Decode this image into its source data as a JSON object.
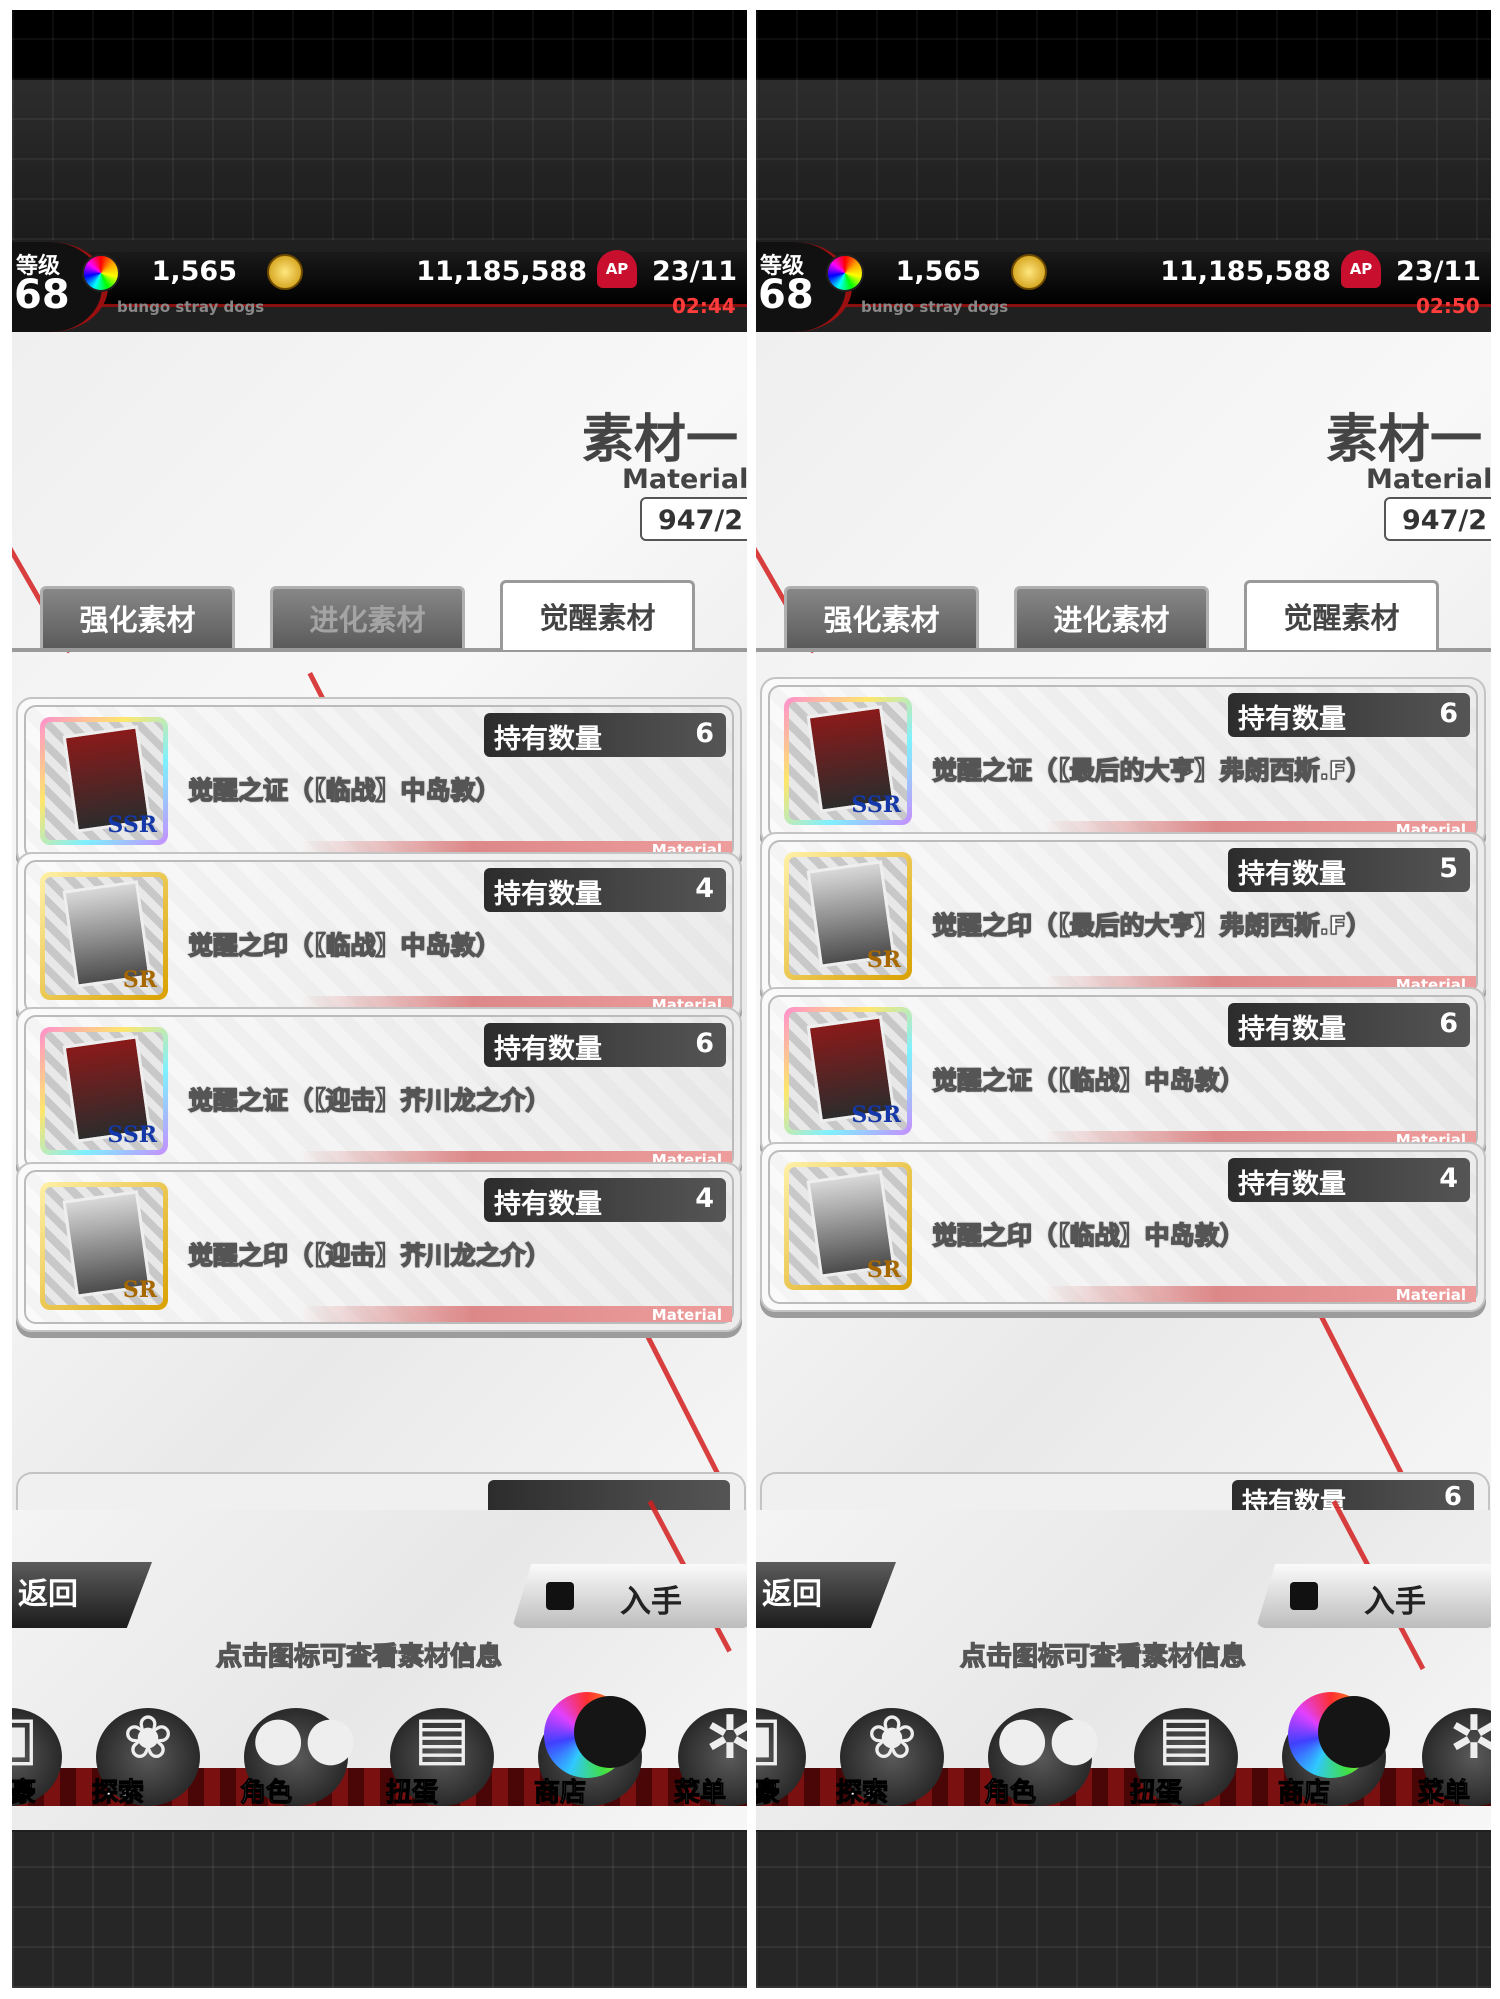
{
  "panels": [
    {
      "header": {
        "level_label": "等级",
        "level_value": "68",
        "gems": "1,565",
        "coins": "11,185,588",
        "ap_icon": "AP",
        "ap": "23/11",
        "time": "02:44",
        "subtitle": "bungo stray dogs"
      },
      "page": {
        "title": "素材一",
        "subtitle": "Material",
        "count": "947/2"
      },
      "tabs": [
        {
          "label": "强化素材",
          "state": "normal"
        },
        {
          "label": "进化素材",
          "state": "dim"
        },
        {
          "label": "觉醒素材",
          "state": "active"
        }
      ],
      "items": [
        {
          "name": "觉醒之证（【临战】中岛敦）",
          "rarity": "SSR",
          "qty_label": "持有数量",
          "qty": "6",
          "tag": "Material"
        },
        {
          "name": "觉醒之印（【临战】中岛敦）",
          "rarity": "SR",
          "qty_label": "持有数量",
          "qty": "4",
          "tag": "Material"
        },
        {
          "name": "觉醒之证（【迎击】芥川龙之介）",
          "rarity": "SSR",
          "qty_label": "持有数量",
          "qty": "6",
          "tag": "Material"
        },
        {
          "name": "觉醒之印（【迎击】芥川龙之介）",
          "rarity": "SR",
          "qty_label": "持有数量",
          "qty": "4",
          "tag": "Material"
        }
      ],
      "peek": {
        "qty_label": "",
        "qty": ""
      },
      "footer": {
        "back": "返回",
        "obtain": "入手",
        "hint": "点击图标可查看素材信息"
      },
      "nav": [
        {
          "label": "豪",
          "icon": "stamp-icon"
        },
        {
          "label": "探索",
          "icon": "tiger-icon"
        },
        {
          "label": "角色",
          "icon": "people-icon"
        },
        {
          "label": "扭蛋",
          "icon": "book-icon"
        },
        {
          "label": "商店",
          "icon": "rainbow-moon-icon"
        },
        {
          "label": "菜单",
          "icon": "gear-icon"
        }
      ]
    },
    {
      "header": {
        "level_label": "等级",
        "level_value": "68",
        "gems": "1,565",
        "coins": "11,185,588",
        "ap_icon": "AP",
        "ap": "23/11",
        "time": "02:50",
        "subtitle": "bungo stray dogs"
      },
      "page": {
        "title": "素材一",
        "subtitle": "Material",
        "count": "947/2"
      },
      "tabs": [
        {
          "label": "强化素材",
          "state": "normal"
        },
        {
          "label": "进化素材",
          "state": "normal"
        },
        {
          "label": "觉醒素材",
          "state": "active"
        }
      ],
      "items": [
        {
          "name": "觉醒之证（【最后的大亨】弗朗西斯.F）",
          "rarity": "SSR",
          "qty_label": "持有数量",
          "qty": "6",
          "tag": "Material"
        },
        {
          "name": "觉醒之印（【最后的大亨】弗朗西斯.F）",
          "rarity": "SR",
          "qty_label": "持有数量",
          "qty": "5",
          "tag": "Material"
        },
        {
          "name": "觉醒之证（【临战】中岛敦）",
          "rarity": "SSR",
          "qty_label": "持有数量",
          "qty": "6",
          "tag": "Material"
        },
        {
          "name": "觉醒之印（【临战】中岛敦）",
          "rarity": "SR",
          "qty_label": "持有数量",
          "qty": "4",
          "tag": "Material"
        }
      ],
      "peek": {
        "qty_label": "持有数量",
        "qty": "6"
      },
      "footer": {
        "back": "返回",
        "obtain": "入手",
        "hint": "点击图标可查看素材信息"
      },
      "nav": [
        {
          "label": "豪",
          "icon": "stamp-icon"
        },
        {
          "label": "探索",
          "icon": "tiger-icon"
        },
        {
          "label": "角色",
          "icon": "people-icon"
        },
        {
          "label": "扭蛋",
          "icon": "book-icon"
        },
        {
          "label": "商店",
          "icon": "rainbow-moon-icon"
        },
        {
          "label": "菜单",
          "icon": "gear-icon"
        }
      ]
    }
  ]
}
